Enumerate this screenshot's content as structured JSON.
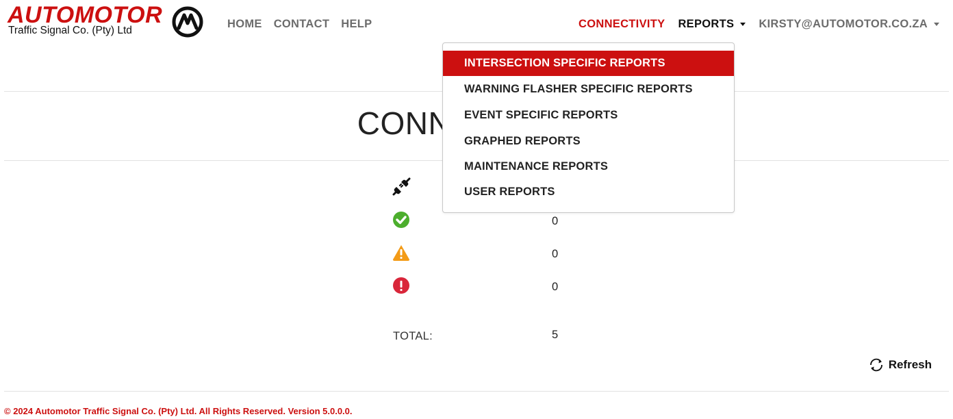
{
  "brand": {
    "name": "AUTOMOTOR",
    "subtitle": "Traffic Signal Co. (Pty) Ltd",
    "accent_color": "#cc1010"
  },
  "nav": {
    "left": [
      "HOME",
      "CONTACT",
      "HELP"
    ],
    "connectivity": "CONNECTIVITY",
    "reports": "REPORTS",
    "user": "KIRSTY@AUTOMOTOR.CO.ZA"
  },
  "page": {
    "title": "CONNECTIVITY"
  },
  "status": [
    {
      "icon": "disconnected-plug-icon",
      "value": ""
    },
    {
      "icon": "check-circle-icon",
      "value": "0"
    },
    {
      "icon": "warning-triangle-icon",
      "value": "0"
    },
    {
      "icon": "error-circle-icon",
      "value": "0"
    }
  ],
  "total": {
    "label": "TOTAL:",
    "value": "5"
  },
  "refresh_label": "Refresh",
  "reports_menu": {
    "items": [
      "INTERSECTION SPECIFIC REPORTS",
      "WARNING FLASHER SPECIFIC REPORTS",
      "EVENT SPECIFIC REPORTS",
      "GRAPHED REPORTS",
      "MAINTENANCE REPORTS",
      "USER REPORTS"
    ],
    "highlighted_index": 0
  },
  "footer": "© 2024 Automotor Traffic Signal Co. (Pty) Ltd. All Rights Reserved. Version 5.0.0.0."
}
